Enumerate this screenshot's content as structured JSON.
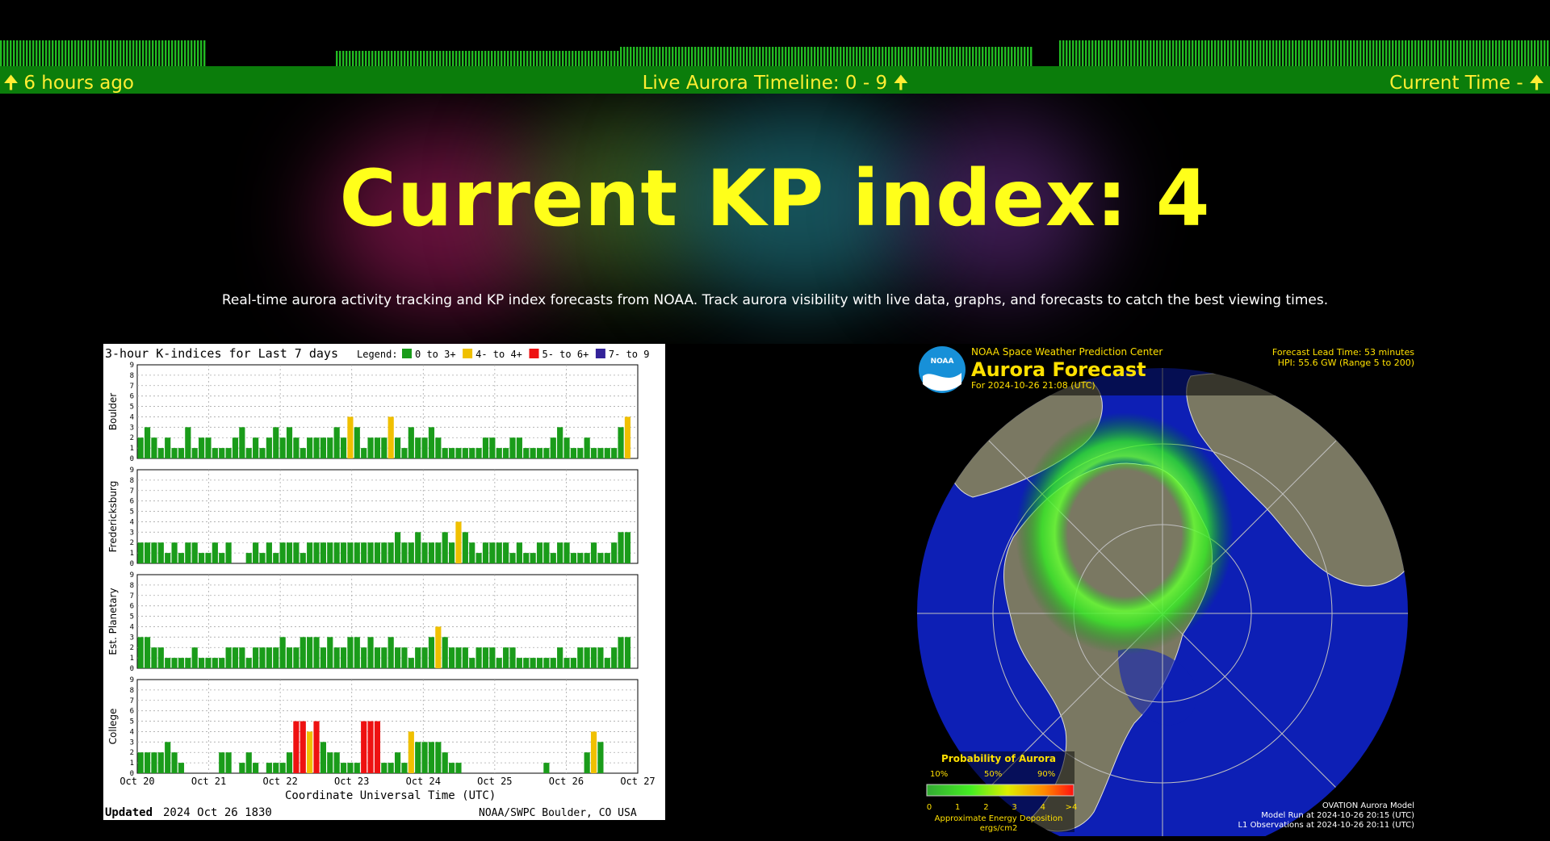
{
  "timeline": {
    "left_label": "6 hours ago",
    "center_label": "Live Aurora Timeline: 0 - 9",
    "right_label": "Current Time -",
    "colors": {
      "bar_bg": "#0b7d0b",
      "text": "#ffee33",
      "ticks": "#22bb22"
    },
    "activity_levels": [
      3,
      3,
      3,
      3,
      3,
      3,
      3,
      3,
      0,
      0,
      0,
      0,
      0,
      1,
      1,
      1,
      1,
      1,
      1,
      1,
      1,
      1,
      1,
      1,
      2,
      2,
      2,
      2,
      2,
      2,
      2,
      2,
      2,
      2,
      2,
      2,
      2,
      2,
      2,
      2,
      0,
      3,
      3,
      3,
      3,
      3,
      3,
      3,
      3,
      3,
      3,
      3,
      3,
      3,
      3,
      3,
      3,
      3,
      3,
      3
    ]
  },
  "hero": {
    "title": "Current KP index: 4",
    "kp_value": 4,
    "description": "Real-time aurora activity tracking and KP index forecasts from NOAA. Track aurora visibility with live data, graphs, and forecasts to catch the best viewing times."
  },
  "kindex_chart": {
    "title": "3-hour K-indices for Last 7 days",
    "legend_label": "Legend:",
    "legend": [
      {
        "label": "0 to 3+",
        "color": "#1a9c1a"
      },
      {
        "label": "4- to 4+",
        "color": "#f0c000"
      },
      {
        "label": "5- to 6+",
        "color": "#ee1111"
      },
      {
        "label": "7- to 9",
        "color": "#332299"
      }
    ],
    "xlabel": "Coordinate Universal Time (UTC)",
    "updated_label": "Updated",
    "updated_value": "2024 Oct 26 1830",
    "source": "NOAA/SWPC Boulder, CO USA",
    "y_ticks": [
      "0",
      "1",
      "2",
      "3",
      "4",
      "5",
      "6",
      "7",
      "8",
      "9"
    ],
    "x_ticks": [
      "Oct 20",
      "Oct 21",
      "Oct 22",
      "Oct 23",
      "Oct 24",
      "Oct 25",
      "Oct 26",
      "Oct 27"
    ]
  },
  "chart_data": [
    {
      "type": "bar",
      "ylim": [
        0,
        9
      ],
      "series": [
        {
          "name": "Boulder",
          "values": [
            2,
            3,
            2,
            1,
            2,
            1,
            1,
            3,
            1,
            2,
            2,
            1,
            1,
            1,
            2,
            3,
            1,
            2,
            1,
            2,
            3,
            2,
            3,
            2,
            1,
            2,
            2,
            2,
            2,
            3,
            2,
            4,
            3,
            1,
            2,
            2,
            2,
            4,
            2,
            1,
            3,
            2,
            2,
            3,
            2,
            1,
            1,
            1,
            1,
            1,
            1,
            2,
            2,
            1,
            1,
            2,
            2,
            1,
            1,
            1,
            1,
            2,
            3,
            2,
            1,
            1,
            2,
            1,
            1,
            1,
            1,
            3,
            4,
            0
          ]
        },
        {
          "name": "Fredericksburg",
          "values": [
            2,
            2,
            2,
            2,
            1,
            2,
            1,
            2,
            2,
            1,
            1,
            2,
            1,
            2,
            0,
            0,
            1,
            2,
            1,
            2,
            1,
            2,
            2,
            2,
            1,
            2,
            2,
            2,
            2,
            2,
            2,
            2,
            2,
            2,
            2,
            2,
            2,
            2,
            3,
            2,
            2,
            3,
            2,
            2,
            2,
            3,
            2,
            4,
            3,
            2,
            1,
            2,
            2,
            2,
            2,
            1,
            2,
            1,
            1,
            2,
            2,
            1,
            2,
            2,
            1,
            1,
            1,
            2,
            1,
            1,
            2,
            3,
            3,
            0
          ]
        },
        {
          "name": "Est. Planetary",
          "values": [
            3,
            3,
            2,
            2,
            1,
            1,
            1,
            1,
            2,
            1,
            1,
            1,
            1,
            2,
            2,
            2,
            1,
            2,
            2,
            2,
            2,
            3,
            2,
            2,
            3,
            3,
            3,
            2,
            3,
            2,
            2,
            3,
            3,
            2,
            3,
            2,
            2,
            3,
            2,
            2,
            1,
            2,
            2,
            3,
            4,
            3,
            2,
            2,
            2,
            1,
            2,
            2,
            2,
            1,
            2,
            2,
            1,
            1,
            1,
            1,
            1,
            1,
            2,
            1,
            1,
            2,
            2,
            2,
            2,
            1,
            2,
            3,
            3,
            0
          ]
        },
        {
          "name": "College",
          "values": [
            2,
            2,
            2,
            2,
            3,
            2,
            1,
            0,
            0,
            0,
            0,
            0,
            2,
            2,
            0,
            1,
            2,
            1,
            0,
            1,
            1,
            1,
            2,
            5,
            5,
            4,
            5,
            3,
            2,
            2,
            1,
            1,
            1,
            5,
            5,
            5,
            1,
            1,
            2,
            1,
            4,
            3,
            3,
            3,
            3,
            2,
            1,
            1,
            0,
            0,
            0,
            0,
            0,
            0,
            0,
            0,
            0,
            0,
            0,
            0,
            1,
            0,
            0,
            0,
            0,
            0,
            2,
            4,
            3,
            0,
            0,
            0,
            0,
            0
          ]
        }
      ]
    }
  ],
  "aurora_map": {
    "agency": "NOAA Space Weather Prediction Center",
    "logo_text": "NOAA",
    "title": "Aurora Forecast",
    "for_line": "For 2024-10-26 21:08 (UTC)",
    "lead_time": "Forecast Lead Time:  53 minutes",
    "hpi": "HPI:  55.6 GW (Range 5 to 200)",
    "probability_title": "Probability of Aurora",
    "probability_ticks": [
      "10%",
      "50%",
      "90%"
    ],
    "energy_ticks": [
      "0",
      "1",
      "2",
      "3",
      "4",
      ">4"
    ],
    "energy_label_1": "Approximate Energy Deposition",
    "energy_label_2": "ergs/cm2",
    "model_name": "OVATION Aurora Model",
    "model_run": "Model Run at 2024-10-26 20:15 (UTC)",
    "l1_obs": "L1 Observations at 2024-10-26 20:11 (UTC)"
  }
}
